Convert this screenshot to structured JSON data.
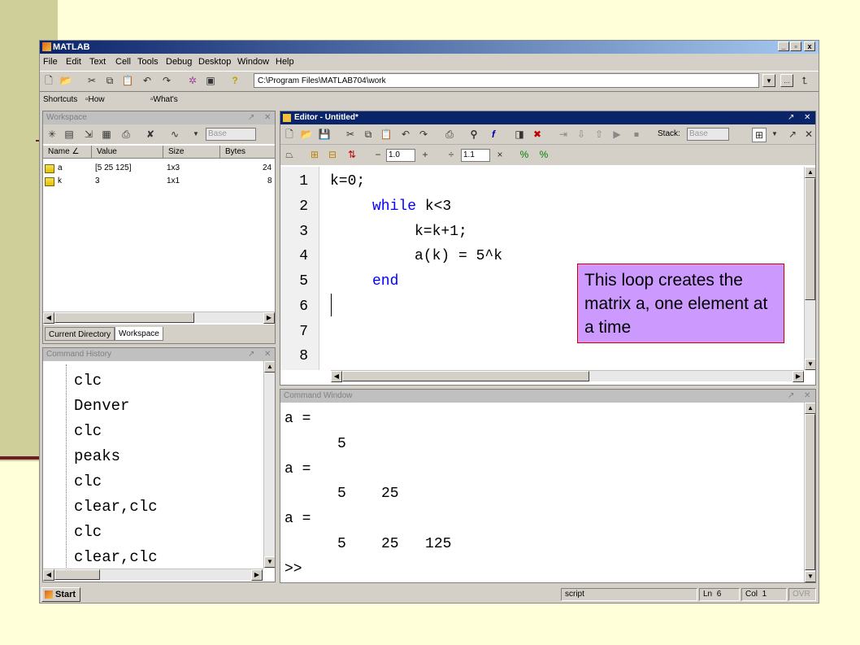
{
  "window": {
    "title": "MATLAB",
    "buttons": [
      "_",
      "▫",
      "x"
    ]
  },
  "menu": [
    "File",
    "Edit",
    "Text",
    "Cell",
    "Tools",
    "Debug",
    "Desktop",
    "Window",
    "Help"
  ],
  "toolbar": {
    "path": "C:\\Program Files\\MATLAB704\\work"
  },
  "shortcuts": {
    "label": "Shortcuts",
    "how_to_add": "How to Add",
    "whats_new": "What's New"
  },
  "workspace": {
    "title": "Workspace",
    "base": "Base",
    "columns": [
      "Name",
      "Value",
      "Size",
      "Bytes"
    ],
    "rows": [
      {
        "name": "a",
        "value": "[5 25 125]",
        "size": "1x3",
        "bytes": "24"
      },
      {
        "name": "k",
        "value": "3",
        "size": "1x1",
        "bytes": "8"
      }
    ],
    "tabs": [
      "Current Directory",
      "Workspace"
    ]
  },
  "history": {
    "title": "Command History",
    "items": [
      "clc",
      "Denver",
      "clc",
      "peaks",
      "clc",
      "clear,clc",
      "clc",
      "clear,clc"
    ]
  },
  "editor": {
    "title": "Editor - Untitled*",
    "stack_label": "Stack:",
    "stack_value": "Base",
    "cell_value1": "1.0",
    "cell_value2": "1.1",
    "line_numbers": [
      "1",
      "2",
      "3",
      "4",
      "5",
      "6",
      "7",
      "8"
    ],
    "code": {
      "l1": "k=0;",
      "l2_kw": "while",
      "l2_rest": " k<3",
      "l3": "k=k+1;",
      "l4": "a(k) = 5^k",
      "l5_kw": "end"
    }
  },
  "command_window": {
    "title": "Command Window",
    "lines": [
      "a =",
      "5",
      "a =",
      "5    25",
      "a =",
      "5    25   125",
      ">>"
    ]
  },
  "annotation": {
    "text": "This loop creates the matrix a, one element at a time"
  },
  "status": {
    "start": "Start",
    "mode": "script",
    "ln_label": "Ln",
    "ln": "6",
    "col_label": "Col",
    "col": "1",
    "ovr": "OVR"
  }
}
